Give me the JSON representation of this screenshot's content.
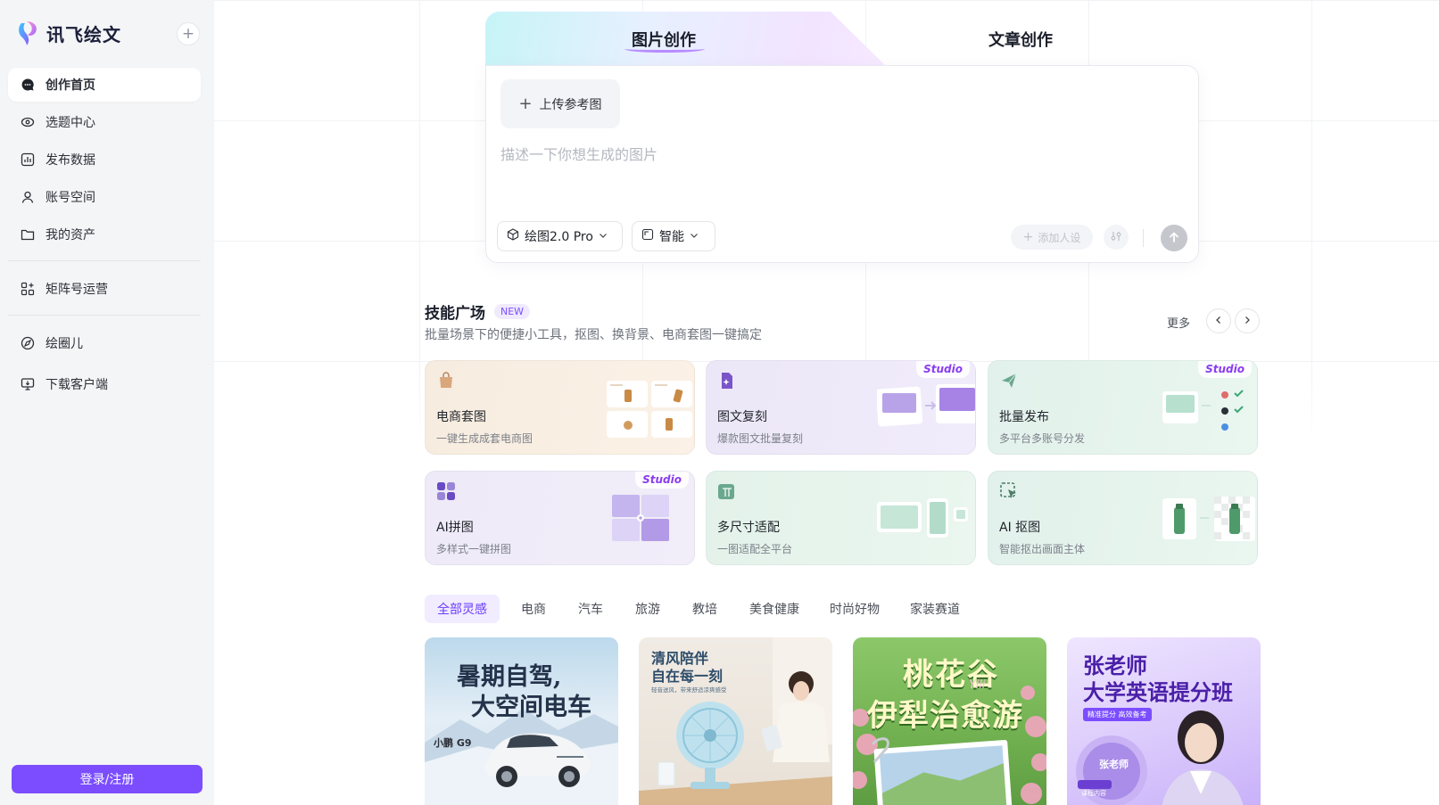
{
  "brand": {
    "name": "讯飞绘文",
    "new_button": "+"
  },
  "sidebar": {
    "items": [
      {
        "label": "创作首页",
        "icon": "chat-bubble-icon",
        "active": true
      },
      {
        "label": "选题中心",
        "icon": "eye-target-icon"
      },
      {
        "label": "发布数据",
        "icon": "bar-chart-icon"
      },
      {
        "label": "账号空间",
        "icon": "user-icon"
      },
      {
        "label": "我的资产",
        "icon": "folder-icon"
      },
      {
        "label": "矩阵号运营",
        "icon": "grid-plus-icon"
      },
      {
        "label": "绘圈儿",
        "icon": "compass-icon"
      },
      {
        "label": "下载客户端",
        "icon": "monitor-download-icon"
      }
    ],
    "login_label": "登录/注册"
  },
  "creation": {
    "tabs": [
      {
        "label": "图片创作",
        "active": true
      },
      {
        "label": "文章创作"
      }
    ],
    "upload_label": "上传参考图",
    "prompt_placeholder": "描述一下你想生成的图片",
    "model_label": "绘图2.0 Pro",
    "mode_label": "智能",
    "persona_label": "添加人设"
  },
  "skills": {
    "title": "技能广场",
    "badge": "NEW",
    "subtitle": "批量场景下的便捷小工具，抠图、换背景、电商套图一键搞定",
    "more_label": "更多",
    "studio_label": "Studio",
    "cards": [
      {
        "title": "电商套图",
        "desc": "一键生成成套电商图",
        "studio": false
      },
      {
        "title": "图文复刻",
        "desc": "爆款图文批量复刻",
        "studio": true
      },
      {
        "title": "批量发布",
        "desc": "多平台多账号分发",
        "studio": true
      },
      {
        "title": "AI拼图",
        "desc": "多样式一键拼图",
        "studio": true
      },
      {
        "title": "多尺寸适配",
        "desc": "一图适配全平台",
        "studio": false
      },
      {
        "title": "AI 抠图",
        "desc": "智能抠出画面主体",
        "studio": false
      }
    ]
  },
  "inspiration": {
    "tabs": [
      "全部灵感",
      "电商",
      "汽车",
      "旅游",
      "教培",
      "美食健康",
      "时尚好物",
      "家装赛道"
    ],
    "active_index": 0
  },
  "gallery": [
    {
      "line1": "暑期自驾,",
      "line2": "大空间电车",
      "tag": "小鹏 G9"
    },
    {
      "line1": "清风陪伴",
      "line2": "自在每一刻",
      "tag": "轻音送风，带来舒适凉爽感受"
    },
    {
      "line1": "桃花谷",
      "line2": "伊犁治愈游",
      "tag": "Yili"
    },
    {
      "line1": "张老师",
      "line2": "大学英语提分班",
      "tag": "精准提分 高效备考",
      "name": "张老师",
      "course": "课程内容"
    }
  ],
  "colors": {
    "accent": "#7b4dff",
    "sidebar_bg": "#f4f5f7",
    "studio": "#8a3cf0"
  }
}
